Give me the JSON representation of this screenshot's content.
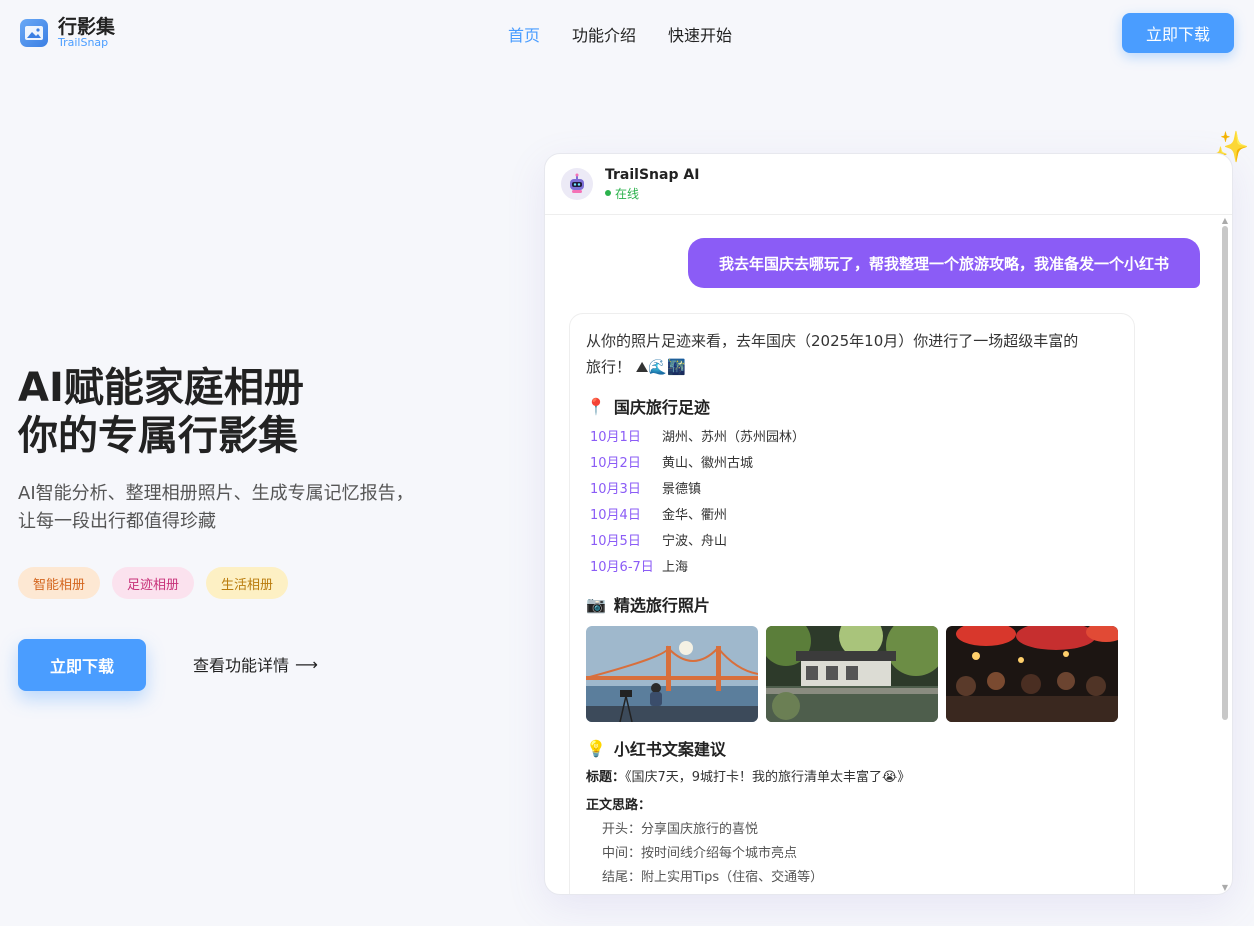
{
  "app": {
    "name": "行影集",
    "subname": "TrailSnap"
  },
  "nav": {
    "items": [
      "首页",
      "功能介绍",
      "快速开始"
    ],
    "download_label": "立即下载"
  },
  "hero": {
    "title_line1": "AI赋能家庭相册",
    "title_line2": "你的专属行影集",
    "desc_line1": "AI智能分析、整理相册照片、生成专属记忆报告，",
    "desc_line2": "让每一段出行都值得珍藏",
    "tags": [
      "智能相册",
      "足迹相册",
      "生活相册"
    ],
    "cta_label": "立即下载",
    "more_label": "查看功能详情",
    "more_arrow": "⟶"
  },
  "chat": {
    "bot_name": "TrailSnap AI",
    "status": "在线",
    "user_message": "我去年国庆去哪玩了，帮我整理一个旅游攻略，我准备发一个小红书",
    "intro_line1": "从你的照片足迹来看，去年国庆（2025年10月）你进行了一场超级丰富的",
    "intro_line2": "旅行！",
    "section_trip": "国庆旅行足迹",
    "trip": [
      {
        "date": "10月1日",
        "place": "湖州、苏州（苏州园林）"
      },
      {
        "date": "10月2日",
        "place": "黄山、徽州古城"
      },
      {
        "date": "10月3日",
        "place": "景德镇"
      },
      {
        "date": "10月4日",
        "place": "金华、衢州"
      },
      {
        "date": "10月5日",
        "place": "宁波、舟山"
      },
      {
        "date": "10月6-7日",
        "place": "上海"
      }
    ],
    "section_photos": "精选旅行照片",
    "section_copy": "小红书文案建议",
    "title_label": "标题：",
    "title_value": "《国庆7天，9城打卡！我的旅行清单太丰富了😭》",
    "body_label": "正文思路：",
    "body_lines": [
      "开头：分享国庆旅行的喜悦",
      "中间：按时间线介绍每个城市亮点",
      "结尾：附上实用Tips（住宿、交通等）"
    ]
  },
  "icons": {
    "logo": "photo-album-icon",
    "avatar": "robot-icon",
    "trip": "pin-icon",
    "photos": "camera-icon",
    "copy": "lightbulb-icon",
    "sparkle": "sparkle-icon"
  },
  "colors": {
    "primary": "#4a9dff",
    "accent": "#8b5cf6",
    "online": "#2bb24c"
  }
}
